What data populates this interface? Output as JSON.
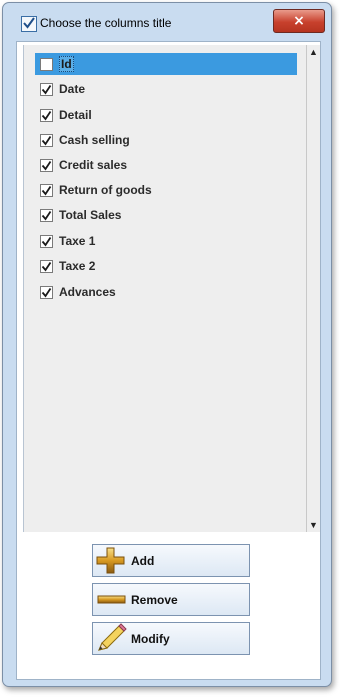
{
  "window": {
    "title": "Choose the columns title",
    "title_checked": true,
    "close_glyph": "×"
  },
  "columns": [
    {
      "label": "Id",
      "checked": false,
      "selected": true
    },
    {
      "label": "Date",
      "checked": true,
      "selected": false
    },
    {
      "label": "Detail",
      "checked": true,
      "selected": false
    },
    {
      "label": "Cash selling",
      "checked": true,
      "selected": false
    },
    {
      "label": "Credit sales",
      "checked": true,
      "selected": false
    },
    {
      "label": "Return of goods",
      "checked": true,
      "selected": false
    },
    {
      "label": "Total Sales",
      "checked": true,
      "selected": false
    },
    {
      "label": "Taxe 1",
      "checked": true,
      "selected": false
    },
    {
      "label": "Taxe 2",
      "checked": true,
      "selected": false
    },
    {
      "label": "Advances",
      "checked": true,
      "selected": false
    }
  ],
  "buttons": {
    "add": {
      "label": "Add",
      "icon": "plus-icon"
    },
    "remove": {
      "label": "Remove",
      "icon": "minus-icon"
    },
    "modify": {
      "label": "Modify",
      "icon": "pencil-icon"
    }
  },
  "scrollbar": {
    "up_glyph": "▲",
    "down_glyph": "▼"
  }
}
